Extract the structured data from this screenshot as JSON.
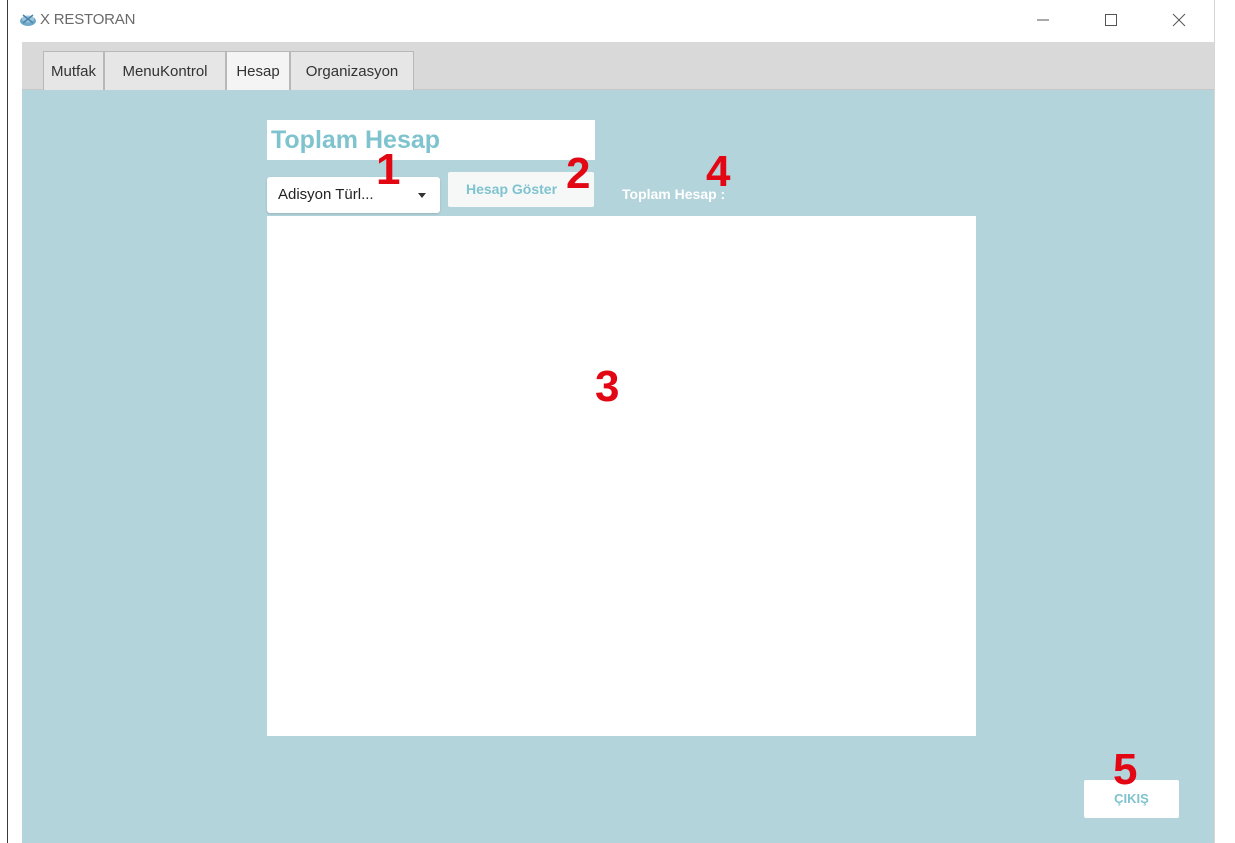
{
  "window": {
    "title": "X RESTORAN",
    "app_icon": "restaurant-logo-icon",
    "controls": {
      "minimize": "minimize-icon",
      "maximize": "maximize-icon",
      "close": "close-icon"
    }
  },
  "tabs": [
    {
      "label": "Mutfak",
      "active": false
    },
    {
      "label": "MenuKontrol",
      "active": false
    },
    {
      "label": "Hesap",
      "active": true
    },
    {
      "label": "Organizasyon",
      "active": false
    }
  ],
  "main": {
    "title": "Toplam Hesap",
    "combo_value": "Adisyon Türl...",
    "show_button_label": "Hesap Göster",
    "total_label": "Toplam Hesap :",
    "exit_button_label": "ÇIKIŞ"
  },
  "annotations": [
    "1",
    "2",
    "3",
    "4",
    "5"
  ],
  "colors": {
    "background": "#b3d4db",
    "accent_text": "#7fc3cf",
    "annotation": "#e30613"
  }
}
